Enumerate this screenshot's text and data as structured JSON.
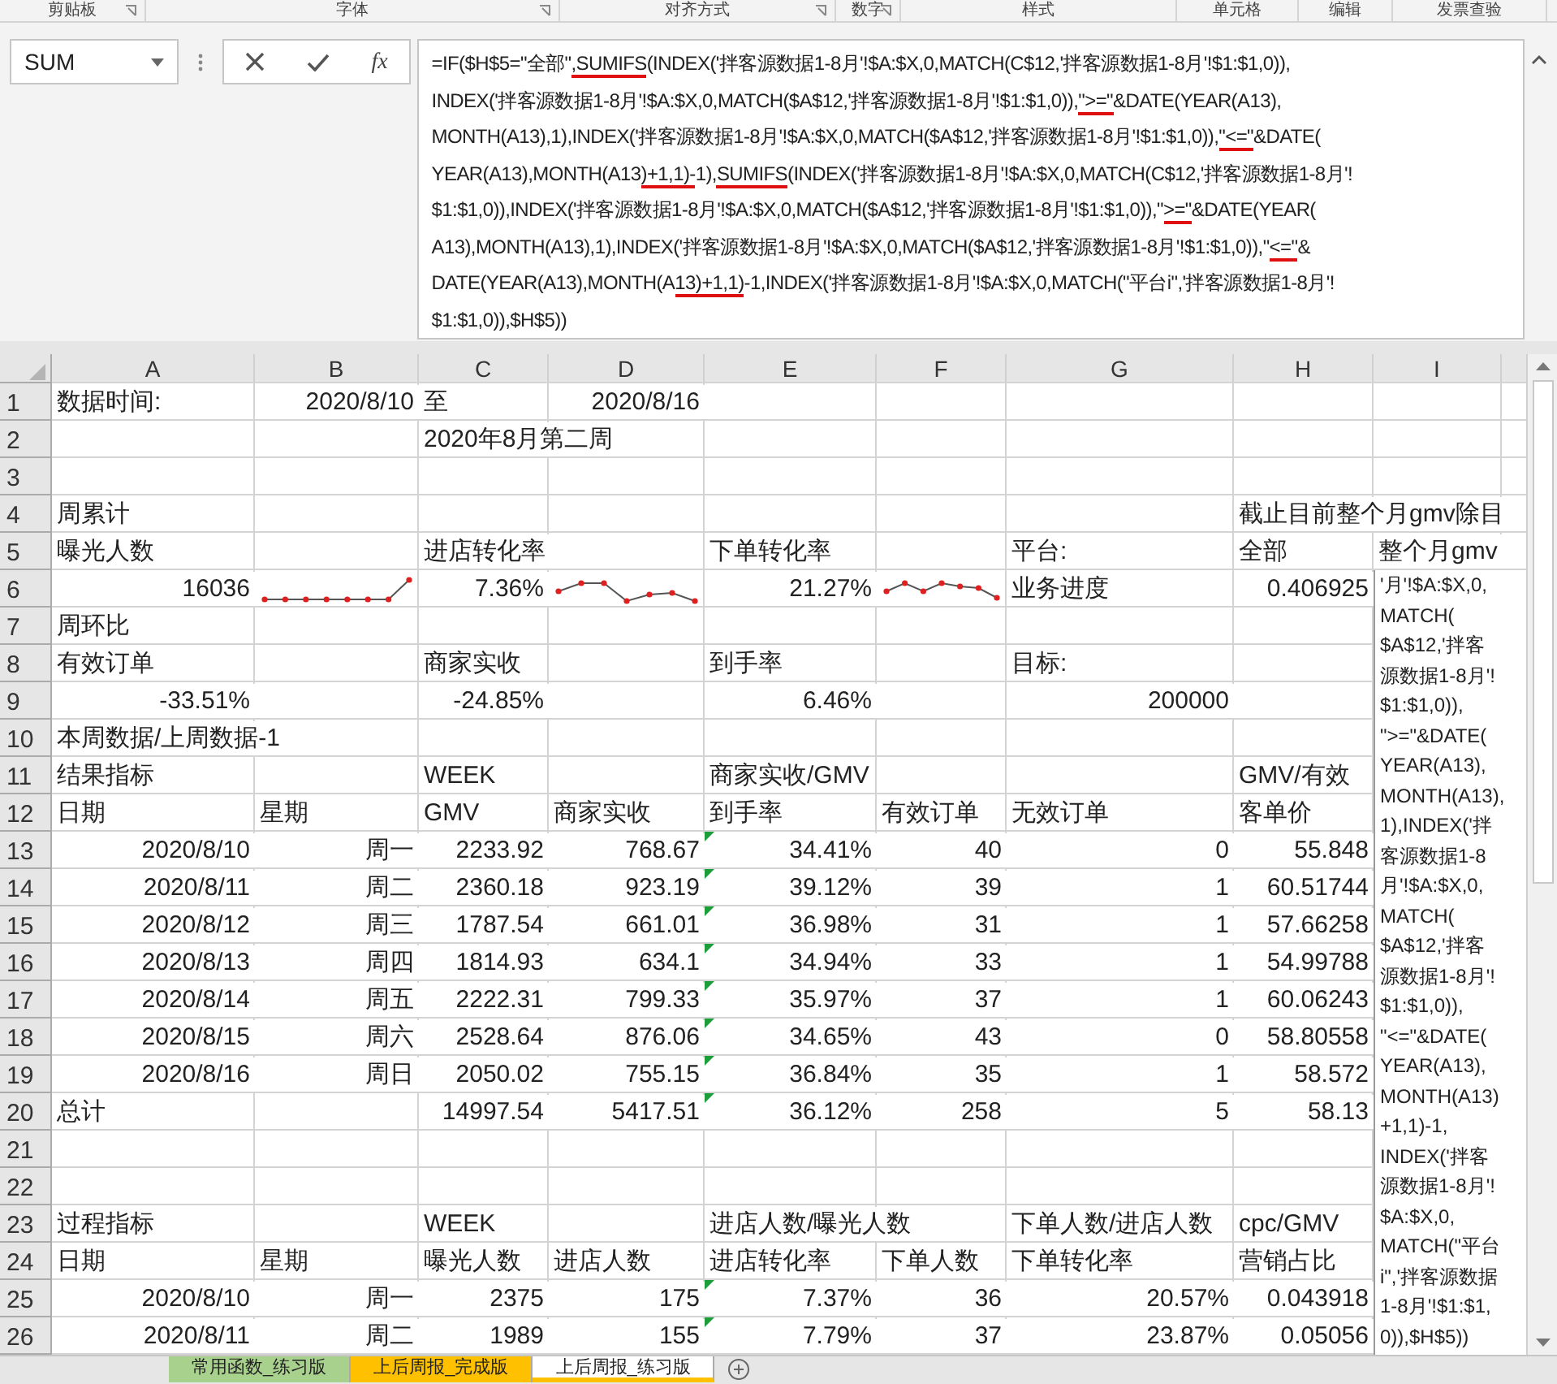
{
  "ribbon_groups": [
    {
      "label": "剪贴板",
      "launcher": true
    },
    {
      "label": "字体",
      "launcher": true
    },
    {
      "label": "对齐方式",
      "launcher": true
    },
    {
      "label": "数字",
      "launcher": true
    },
    {
      "label": "样式",
      "launcher": false
    },
    {
      "label": "单元格",
      "launcher": false
    },
    {
      "label": "编辑",
      "launcher": false
    },
    {
      "label": "发票查验",
      "launcher": false
    }
  ],
  "name_box": {
    "value": "SUM"
  },
  "formula_bar": {
    "function_button": "fx",
    "lines": [
      [
        {
          "text": "=IF($H$5=\"全部\"",
          "marked": false
        },
        {
          "text": ",SUMIFS",
          "marked": true
        },
        {
          "text": "(INDEX('拌客源数据1-8月'!$A:$X,0,MATCH(C$12,'拌客源数据1-8月'!$1:$1,0)),",
          "marked": false
        }
      ],
      [
        {
          "text": "INDEX('拌客源数据1-8月'!$A:$X,0,MATCH($A$12,'拌客源数据1-8月'!$1:$1,0)),",
          "marked": false
        },
        {
          "text": "\">=\"",
          "marked": true
        },
        {
          "text": "&DATE(YEAR(A13),",
          "marked": false
        }
      ],
      [
        {
          "text": "MONTH(A13),1),INDEX('拌客源数据1-8月'!$A:$X,0,MATCH($A$12,'拌客源数据1-8月'!$1:$1,0)),",
          "marked": false
        },
        {
          "text": "\"<=\"",
          "marked": true
        },
        {
          "text": "&DATE(",
          "marked": false
        }
      ],
      [
        {
          "text": "YEAR(A13),MONTH(A13",
          "marked": false
        },
        {
          "text": ")+1,1)-",
          "marked": true
        },
        {
          "text": "1),",
          "marked": false
        },
        {
          "text": "SUMIFS",
          "marked": true
        },
        {
          "text": "(INDEX('拌客源数据1-8月'!$A:$X,0,MATCH(C$12,'拌客源数据1-8月'!",
          "marked": false
        }
      ],
      [
        {
          "text": "$1:$1,0)),INDEX('拌客源数据1-8月'!$A:$X,0,MATCH($A$12,'拌客源数据1-8月'!$1:$1,0)),\"",
          "marked": false
        },
        {
          "text": ">=\"",
          "marked": true
        },
        {
          "text": "&DATE(YEAR(",
          "marked": false
        }
      ],
      [
        {
          "text": "A13),MONTH(A13),1),INDEX('拌客源数据1-8月'!$A:$X,0,MATCH($A$12,'拌客源数据1-8月'!$1:$1,0)),\"",
          "marked": false
        },
        {
          "text": "<=\"",
          "marked": true
        },
        {
          "text": "&",
          "marked": false
        }
      ],
      [
        {
          "text": "DATE(YEAR(A13),MONTH(A",
          "marked": false
        },
        {
          "text": "13)+1,1)",
          "marked": true
        },
        {
          "text": "-1,INDEX('拌客源数据1-8月'!$A:$X,0,MATCH(\"平台i\",'拌客源数据1-8月'!",
          "marked": false
        }
      ],
      [
        {
          "text": "$1:$1,0)),$H$5))",
          "marked": false
        }
      ]
    ]
  },
  "columns": [
    "A",
    "B",
    "C",
    "D",
    "E",
    "F",
    "G",
    "H",
    "I"
  ],
  "rows": [
    {
      "n": "1",
      "cells": {
        "A": {
          "text": "数据时间:",
          "kind": "label"
        },
        "B": {
          "text": "2020/8/10",
          "kind": "value"
        },
        "C": {
          "text": "至",
          "kind": "label"
        },
        "D": {
          "text": "2020/8/16",
          "kind": "value"
        }
      }
    },
    {
      "n": "2",
      "cells": {
        "C": {
          "text": "2020年8月第二周",
          "kind": "label"
        }
      }
    },
    {
      "n": "3",
      "cells": {}
    },
    {
      "n": "4",
      "cells": {
        "A": {
          "text": "周累计",
          "kind": "label"
        },
        "H": {
          "text": "截止目前整个月gmv除目",
          "kind": "label"
        }
      }
    },
    {
      "n": "5",
      "cells": {
        "A": {
          "text": "曝光人数",
          "kind": "label"
        },
        "C": {
          "text": "进店转化率",
          "kind": "label"
        },
        "E": {
          "text": "下单转化率",
          "kind": "label"
        },
        "G": {
          "text": "平台:",
          "kind": "label"
        },
        "H": {
          "text": "全部",
          "kind": "label"
        },
        "I": {
          "text": "整个月gmv",
          "kind": "label"
        }
      }
    },
    {
      "n": "6",
      "cells": {
        "A": {
          "text": "16036",
          "kind": "value"
        },
        "B": {
          "kind": "sparkline"
        },
        "C": {
          "text": "7.36%",
          "kind": "value"
        },
        "D": {
          "kind": "sparkline"
        },
        "E": {
          "text": "21.27%",
          "kind": "value"
        },
        "F": {
          "kind": "sparkline"
        },
        "G": {
          "text": "业务进度",
          "kind": "label"
        },
        "H": {
          "text": "0.406925",
          "kind": "value"
        }
      }
    },
    {
      "n": "7",
      "cells": {
        "A": {
          "text": "周环比",
          "kind": "label"
        }
      }
    },
    {
      "n": "8",
      "cells": {
        "A": {
          "text": "有效订单",
          "kind": "label"
        },
        "C": {
          "text": "商家实收",
          "kind": "label"
        },
        "E": {
          "text": "到手率",
          "kind": "label"
        },
        "G": {
          "text": "目标:",
          "kind": "label"
        }
      }
    },
    {
      "n": "9",
      "cells": {
        "A": {
          "text": "-33.51%",
          "kind": "value"
        },
        "C": {
          "text": "-24.85%",
          "kind": "value"
        },
        "E": {
          "text": "6.46%",
          "kind": "value"
        },
        "G": {
          "text": "200000",
          "kind": "value"
        }
      }
    },
    {
      "n": "10",
      "cells": {
        "A": {
          "text": "本周数据/上周数据-1",
          "kind": "label"
        }
      }
    },
    {
      "n": "11",
      "cells": {
        "A": {
          "text": "结果指标",
          "kind": "label"
        },
        "C": {
          "text": "WEEK",
          "kind": "label"
        },
        "E": {
          "text": "商家实收/GMV",
          "kind": "label"
        },
        "H": {
          "text": "GMV/有效",
          "kind": "label"
        }
      }
    },
    {
      "n": "12",
      "cells": {
        "A": {
          "text": "日期",
          "kind": "label"
        },
        "B": {
          "text": "星期",
          "kind": "label"
        },
        "C": {
          "text": "GMV",
          "kind": "label"
        },
        "D": {
          "text": "商家实收",
          "kind": "label"
        },
        "E": {
          "text": "到手率",
          "kind": "label"
        },
        "F": {
          "text": "有效订单",
          "kind": "label"
        },
        "G": {
          "text": "无效订单",
          "kind": "label"
        },
        "H": {
          "text": "客单价",
          "kind": "label"
        }
      }
    },
    {
      "n": "13",
      "e_marker": true,
      "cells": {
        "A": {
          "text": "2020/8/10",
          "kind": "value"
        },
        "B": {
          "text": "周一",
          "kind": "value"
        },
        "C": {
          "text": "2233.92",
          "kind": "value"
        },
        "D": {
          "text": "768.67",
          "kind": "value"
        },
        "E": {
          "text": "34.41%",
          "kind": "value"
        },
        "F": {
          "text": "40",
          "kind": "value"
        },
        "G": {
          "text": "0",
          "kind": "value"
        },
        "H": {
          "text": "55.848",
          "kind": "value"
        }
      }
    },
    {
      "n": "14",
      "e_marker": true,
      "cells": {
        "A": {
          "text": "2020/8/11",
          "kind": "value"
        },
        "B": {
          "text": "周二",
          "kind": "value"
        },
        "C": {
          "text": "2360.18",
          "kind": "value"
        },
        "D": {
          "text": "923.19",
          "kind": "value"
        },
        "E": {
          "text": "39.12%",
          "kind": "value"
        },
        "F": {
          "text": "39",
          "kind": "value"
        },
        "G": {
          "text": "1",
          "kind": "value"
        },
        "H": {
          "text": "60.51744",
          "kind": "value"
        }
      }
    },
    {
      "n": "15",
      "e_marker": true,
      "cells": {
        "A": {
          "text": "2020/8/12",
          "kind": "value"
        },
        "B": {
          "text": "周三",
          "kind": "value"
        },
        "C": {
          "text": "1787.54",
          "kind": "value"
        },
        "D": {
          "text": "661.01",
          "kind": "value"
        },
        "E": {
          "text": "36.98%",
          "kind": "value"
        },
        "F": {
          "text": "31",
          "kind": "value"
        },
        "G": {
          "text": "1",
          "kind": "value"
        },
        "H": {
          "text": "57.66258",
          "kind": "value"
        }
      }
    },
    {
      "n": "16",
      "e_marker": true,
      "cells": {
        "A": {
          "text": "2020/8/13",
          "kind": "value"
        },
        "B": {
          "text": "周四",
          "kind": "value"
        },
        "C": {
          "text": "1814.93",
          "kind": "value"
        },
        "D": {
          "text": "634.1",
          "kind": "value"
        },
        "E": {
          "text": "34.94%",
          "kind": "value"
        },
        "F": {
          "text": "33",
          "kind": "value"
        },
        "G": {
          "text": "1",
          "kind": "value"
        },
        "H": {
          "text": "54.99788",
          "kind": "value"
        }
      }
    },
    {
      "n": "17",
      "e_marker": true,
      "cells": {
        "A": {
          "text": "2020/8/14",
          "kind": "value"
        },
        "B": {
          "text": "周五",
          "kind": "value"
        },
        "C": {
          "text": "2222.31",
          "kind": "value"
        },
        "D": {
          "text": "799.33",
          "kind": "value"
        },
        "E": {
          "text": "35.97%",
          "kind": "value"
        },
        "F": {
          "text": "37",
          "kind": "value"
        },
        "G": {
          "text": "1",
          "kind": "value"
        },
        "H": {
          "text": "60.06243",
          "kind": "value"
        }
      }
    },
    {
      "n": "18",
      "e_marker": true,
      "cells": {
        "A": {
          "text": "2020/8/15",
          "kind": "value"
        },
        "B": {
          "text": "周六",
          "kind": "value"
        },
        "C": {
          "text": "2528.64",
          "kind": "value"
        },
        "D": {
          "text": "876.06",
          "kind": "value"
        },
        "E": {
          "text": "34.65%",
          "kind": "value"
        },
        "F": {
          "text": "43",
          "kind": "value"
        },
        "G": {
          "text": "0",
          "kind": "value"
        },
        "H": {
          "text": "58.80558",
          "kind": "value"
        }
      }
    },
    {
      "n": "19",
      "e_marker": true,
      "cells": {
        "A": {
          "text": "2020/8/16",
          "kind": "value"
        },
        "B": {
          "text": "周日",
          "kind": "value"
        },
        "C": {
          "text": "2050.02",
          "kind": "value"
        },
        "D": {
          "text": "755.15",
          "kind": "value"
        },
        "E": {
          "text": "36.84%",
          "kind": "value"
        },
        "F": {
          "text": "35",
          "kind": "value"
        },
        "G": {
          "text": "1",
          "kind": "value"
        },
        "H": {
          "text": "58.572",
          "kind": "value"
        }
      }
    },
    {
      "n": "20",
      "e_marker": true,
      "cells": {
        "A": {
          "text": "总计",
          "kind": "label"
        },
        "C": {
          "text": "14997.54",
          "kind": "value"
        },
        "D": {
          "text": "5417.51",
          "kind": "value"
        },
        "E": {
          "text": "36.12%",
          "kind": "value"
        },
        "F": {
          "text": "258",
          "kind": "value"
        },
        "G": {
          "text": "5",
          "kind": "value"
        },
        "H": {
          "text": "58.13",
          "kind": "value"
        }
      }
    },
    {
      "n": "21",
      "cells": {}
    },
    {
      "n": "22",
      "cells": {}
    },
    {
      "n": "23",
      "cells": {
        "A": {
          "text": "过程指标",
          "kind": "label"
        },
        "C": {
          "text": "WEEK",
          "kind": "label"
        },
        "E": {
          "text": "进店人数/曝光人数",
          "kind": "label"
        },
        "G": {
          "text": "下单人数/进店人数",
          "kind": "label"
        },
        "H": {
          "text": "cpc/GMV",
          "kind": "label"
        }
      }
    },
    {
      "n": "24",
      "cells": {
        "A": {
          "text": "日期",
          "kind": "label"
        },
        "B": {
          "text": "星期",
          "kind": "label"
        },
        "C": {
          "text": "曝光人数",
          "kind": "label"
        },
        "D": {
          "text": "进店人数",
          "kind": "label"
        },
        "E": {
          "text": "进店转化率",
          "kind": "label"
        },
        "F": {
          "text": "下单人数",
          "kind": "label"
        },
        "G": {
          "text": "下单转化率",
          "kind": "label"
        },
        "H": {
          "text": "营销占比",
          "kind": "label"
        }
      }
    },
    {
      "n": "25",
      "e_marker": true,
      "cells": {
        "A": {
          "text": "2020/8/10",
          "kind": "value"
        },
        "B": {
          "text": "周一",
          "kind": "value"
        },
        "C": {
          "text": "2375",
          "kind": "value"
        },
        "D": {
          "text": "175",
          "kind": "value"
        },
        "E": {
          "text": "7.37%",
          "kind": "value"
        },
        "F": {
          "text": "36",
          "kind": "value"
        },
        "G": {
          "text": "20.57%",
          "kind": "value"
        },
        "H": {
          "text": "0.043918",
          "kind": "value"
        }
      }
    },
    {
      "n": "26",
      "e_marker": true,
      "cells": {
        "A": {
          "text": "2020/8/11",
          "kind": "value"
        },
        "B": {
          "text": "周二",
          "kind": "value"
        },
        "C": {
          "text": "1989",
          "kind": "value"
        },
        "D": {
          "text": "155",
          "kind": "value"
        },
        "E": {
          "text": "7.79%",
          "kind": "value"
        },
        "F": {
          "text": "37",
          "kind": "value"
        },
        "G": {
          "text": "23.87%",
          "kind": "value"
        },
        "H": {
          "text": "0.05056",
          "kind": "value"
        }
      }
    }
  ],
  "cell_editor": {
    "lines": [
      "'月'!$A:$X,0,",
      "MATCH(",
      "$A$12,'拌客",
      "源数据1-8月'!",
      "$1:$1,0)),",
      "\">=\"&DATE(",
      "YEAR(A13),",
      "MONTH(A13),",
      "1),INDEX('拌",
      "客源数据1-8",
      "月'!$A:$X,0,",
      "MATCH(",
      "$A$12,'拌客",
      "源数据1-8月'!",
      "$1:$1,0)),",
      "\"<=\"&DATE(",
      "YEAR(A13),",
      "MONTH(A13)",
      "+1,1)-1,",
      "INDEX('拌客",
      "源数据1-8月'!",
      "$A:$X,0,",
      "MATCH(\"平台",
      "i\",'拌客源数据",
      "1-8月'!$1:$1,",
      "0)),$H$5))"
    ]
  },
  "sheet_tabs": [
    {
      "label": "常用函数_练习版",
      "color": "#a9d18e",
      "selected": false
    },
    {
      "label": "上后周报_完成版",
      "color": "#ffc000",
      "selected": false
    },
    {
      "label": "上后周报_练习版",
      "color": "#ffc000",
      "selected": true
    }
  ]
}
